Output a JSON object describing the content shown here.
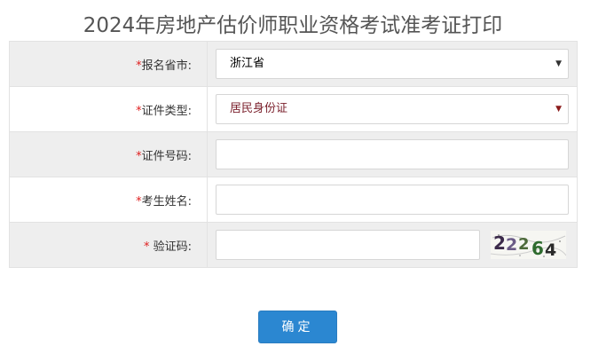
{
  "page": {
    "title": "2024年房地产估价师职业资格考试准考证打印"
  },
  "form": {
    "rows": [
      {
        "required_mark": "*",
        "label": "报名省市:",
        "type": "select",
        "value": "浙江省"
      },
      {
        "required_mark": "*",
        "label": "证件类型:",
        "type": "select",
        "value": "居民身份证"
      },
      {
        "required_mark": "*",
        "label": "证件号码:",
        "type": "input",
        "value": ""
      },
      {
        "required_mark": "*",
        "label": "考生姓名:",
        "type": "input",
        "value": ""
      },
      {
        "required_mark": "*",
        "label": " 验证码:",
        "type": "captcha",
        "value": ""
      }
    ],
    "captcha_text": "22264",
    "submit_label": "确定"
  },
  "colors": {
    "accent": "#2b87d1",
    "required": "#e02020",
    "row_shade": "#eeeeee"
  },
  "icons": {
    "dropdown": "triangle-down-icon"
  }
}
